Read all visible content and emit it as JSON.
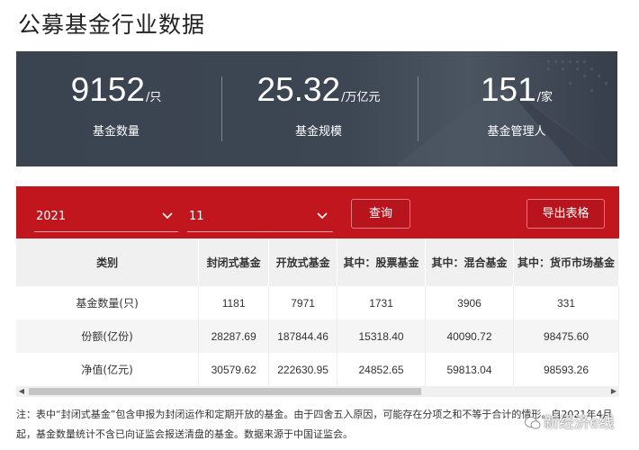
{
  "page": {
    "title": "公募基金行业数据"
  },
  "stats": [
    {
      "value": "9152",
      "unit": "/只",
      "label": "基金数量"
    },
    {
      "value": "25.32",
      "unit": "/万亿元",
      "label": "基金规模"
    },
    {
      "value": "151",
      "unit": "/家",
      "label": "基金管理人"
    }
  ],
  "filters": {
    "year": "2021",
    "month": "11",
    "query_label": "查询",
    "export_label": "导出表格"
  },
  "table": {
    "headers": [
      "类别",
      "封闭式基金",
      "开放式基金",
      "其中：股票基金",
      "其中：混合基金",
      "其中：货币市场基金"
    ],
    "rows": [
      [
        "基金数量(只)",
        "1181",
        "7971",
        "1731",
        "3906",
        "331"
      ],
      [
        "份额(亿份)",
        "28287.69",
        "187844.46",
        "15318.40",
        "40090.72",
        "98475.60"
      ],
      [
        "净值(亿元)",
        "30579.62",
        "222630.95",
        "24852.65",
        "59813.04",
        "98593.26"
      ]
    ]
  },
  "note": "注：表中“封闭式基金”包含申报为封闭运作和定期开放的基金。由于四舍五入原因，可能存在分项之和不等于合计的情形。自2021年4月起，基金数量统计不含已向证监会报送清盘的基金。数据来源于中国证监会。",
  "watermark": "新经济e线",
  "colors": {
    "banner": "#3a4350",
    "accent_red": "#c2161f",
    "header_bg": "#f0f0f0"
  }
}
